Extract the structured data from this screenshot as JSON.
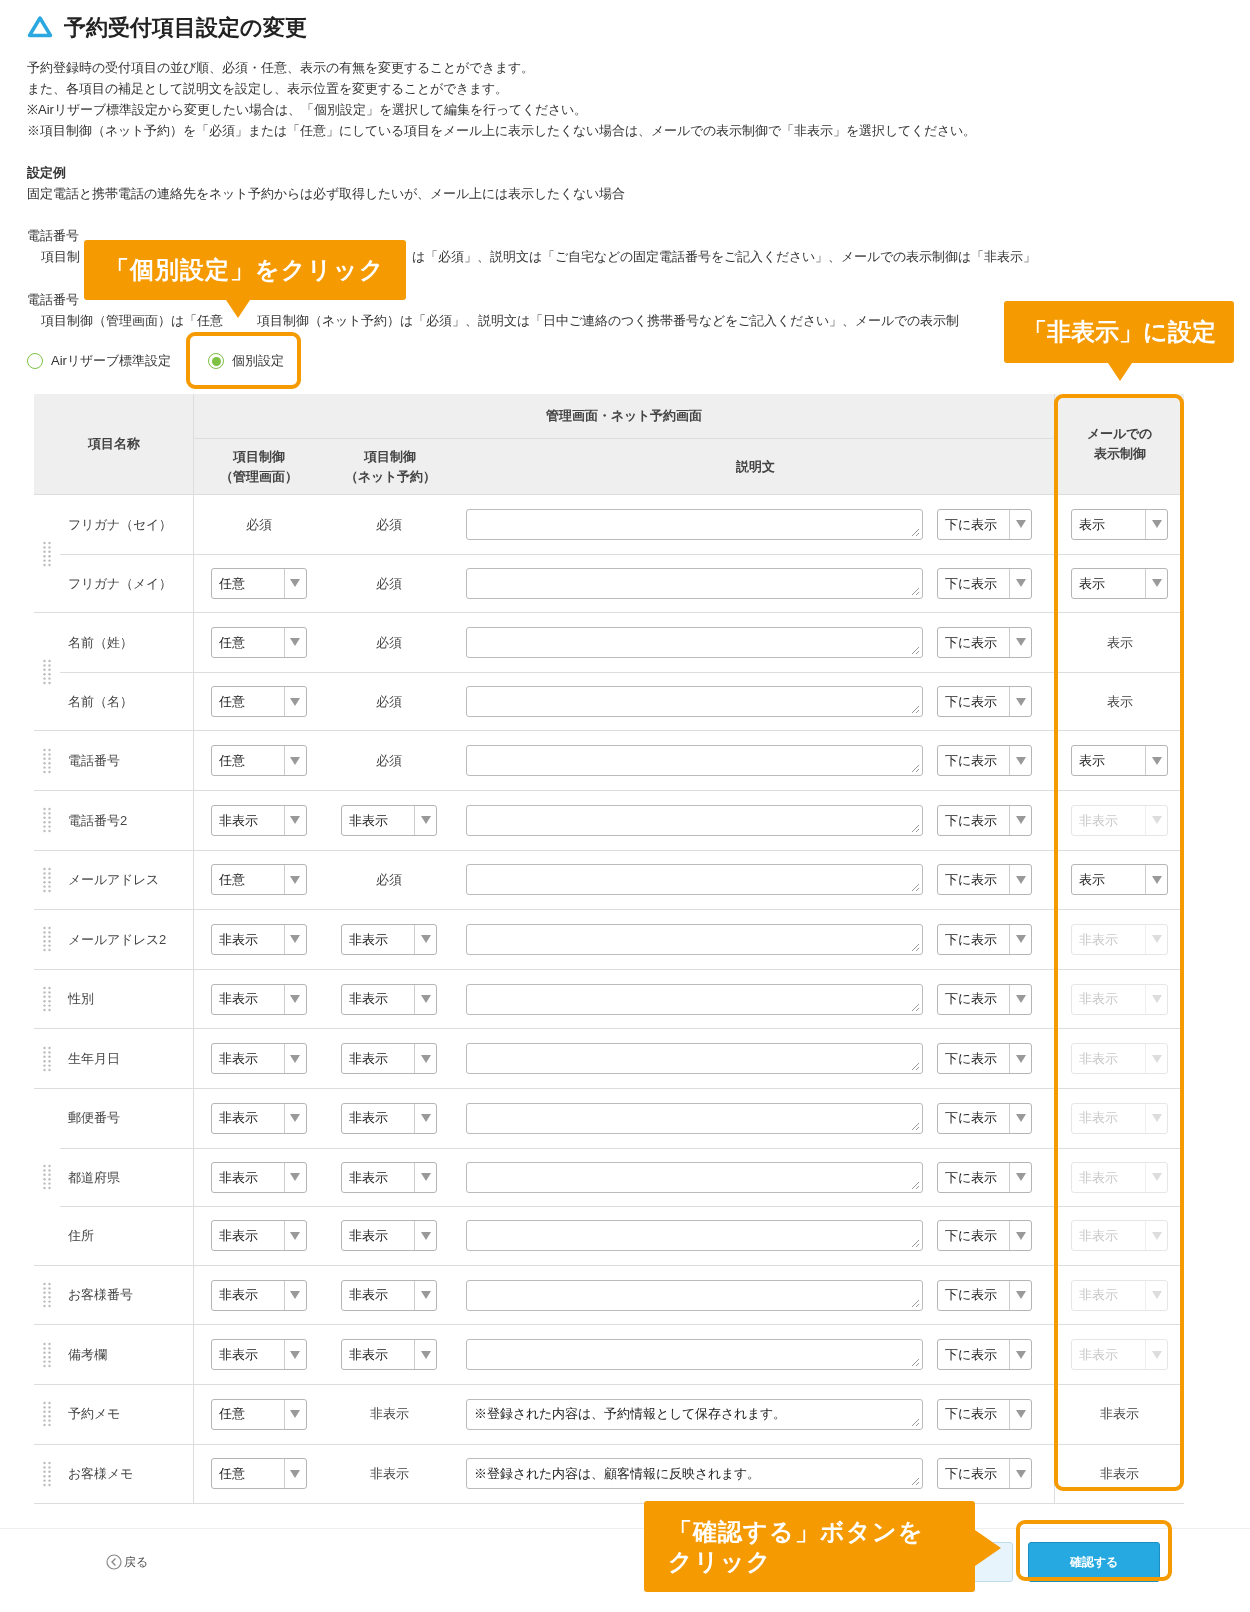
{
  "page": {
    "title": "予約受付項目設定の変更"
  },
  "intro": [
    "予約登録時の受付項目の並び順、必須・任意、表示の有無を変更することができます。",
    "また、各項目の補足として説明文を設定し、表示位置を変更することができます。",
    "※Airリザーブ標準設定から変更したい場合は、「個別設定」を選択して編集を行ってください。",
    "※項目制御（ネット予約）を「必須」または「任意」にしている項目をメール上に表示したくない場合は、メールでの表示制御で「非表示」を選択してください。"
  ],
  "example": {
    "heading": "設定例",
    "text": "固定電話と携帯電話の連絡先をネット予約からは必ず取得したいが、メール上には表示したくない場合",
    "items": [
      {
        "label": "電話番号",
        "segments": [
          "項目制",
          "は「必須」、説明文は「ご自宅などの固定電話番号をご記入ください」、メールでの表示制御は「非表示」"
        ]
      },
      {
        "label": "電話番号",
        "segments": [
          "項目制御（管理画面）は「任意",
          "項目制御（ネット予約）は「必須」、説明文は「日中ご連絡のつく携帯番号などをご記入ください」、メールでの表示制"
        ]
      }
    ]
  },
  "mode": [
    {
      "label": "Airリザーブ標準設定",
      "selected": false
    },
    {
      "label": "個別設定",
      "selected": true
    }
  ],
  "table": {
    "columns": {
      "name": "項目名称",
      "group": "管理画面・ネット予約画面",
      "admin": [
        "項目制御",
        "（管理画面）"
      ],
      "net": [
        "項目制御",
        "（ネット予約）"
      ],
      "description": "説明文",
      "mail": [
        "メールでの",
        "表示制御"
      ]
    },
    "groups": [
      {
        "rows": [
          {
            "name": "フリガナ（セイ）",
            "admin": {
              "kind": "text",
              "value": "必須"
            },
            "net": {
              "kind": "text",
              "value": "必須"
            },
            "position": "下に表示",
            "mail": {
              "kind": "select",
              "value": "表示",
              "disabled": false
            }
          },
          {
            "name": "フリガナ（メイ）",
            "admin": {
              "kind": "select",
              "value": "任意"
            },
            "net": {
              "kind": "text",
              "value": "必須"
            },
            "position": "下に表示",
            "mail": {
              "kind": "select",
              "value": "表示",
              "disabled": false
            }
          }
        ]
      },
      {
        "rows": [
          {
            "name": "名前（姓）",
            "admin": {
              "kind": "select",
              "value": "任意"
            },
            "net": {
              "kind": "text",
              "value": "必須"
            },
            "position": "下に表示",
            "mail": {
              "kind": "text",
              "value": "表示"
            }
          },
          {
            "name": "名前（名）",
            "admin": {
              "kind": "select",
              "value": "任意"
            },
            "net": {
              "kind": "text",
              "value": "必須"
            },
            "position": "下に表示",
            "mail": {
              "kind": "text",
              "value": "表示"
            }
          }
        ]
      },
      {
        "rows": [
          {
            "name": "電話番号",
            "admin": {
              "kind": "select",
              "value": "任意"
            },
            "net": {
              "kind": "text",
              "value": "必須"
            },
            "position": "下に表示",
            "mail": {
              "kind": "select",
              "value": "表示",
              "disabled": false
            }
          }
        ]
      },
      {
        "rows": [
          {
            "name": "電話番号2",
            "admin": {
              "kind": "select",
              "value": "非表示"
            },
            "net": {
              "kind": "select",
              "value": "非表示"
            },
            "position": "下に表示",
            "mail": {
              "kind": "select",
              "value": "非表示",
              "disabled": true
            }
          }
        ]
      },
      {
        "rows": [
          {
            "name": "メールアドレス",
            "admin": {
              "kind": "select",
              "value": "任意"
            },
            "net": {
              "kind": "text",
              "value": "必須"
            },
            "position": "下に表示",
            "mail": {
              "kind": "select",
              "value": "表示",
              "disabled": false
            }
          }
        ]
      },
      {
        "rows": [
          {
            "name": "メールアドレス2",
            "admin": {
              "kind": "select",
              "value": "非表示"
            },
            "net": {
              "kind": "select",
              "value": "非表示"
            },
            "position": "下に表示",
            "mail": {
              "kind": "select",
              "value": "非表示",
              "disabled": true
            }
          }
        ]
      },
      {
        "rows": [
          {
            "name": "性別",
            "admin": {
              "kind": "select",
              "value": "非表示"
            },
            "net": {
              "kind": "select",
              "value": "非表示"
            },
            "position": "下に表示",
            "mail": {
              "kind": "select",
              "value": "非表示",
              "disabled": true
            }
          }
        ]
      },
      {
        "rows": [
          {
            "name": "生年月日",
            "admin": {
              "kind": "select",
              "value": "非表示"
            },
            "net": {
              "kind": "select",
              "value": "非表示"
            },
            "position": "下に表示",
            "mail": {
              "kind": "select",
              "value": "非表示",
              "disabled": true
            }
          }
        ]
      },
      {
        "rows": [
          {
            "name": "郵便番号",
            "admin": {
              "kind": "select",
              "value": "非表示"
            },
            "net": {
              "kind": "select",
              "value": "非表示"
            },
            "position": "下に表示",
            "mail": {
              "kind": "select",
              "value": "非表示",
              "disabled": true
            }
          },
          {
            "name": "都道府県",
            "admin": {
              "kind": "select",
              "value": "非表示"
            },
            "net": {
              "kind": "select",
              "value": "非表示"
            },
            "position": "下に表示",
            "mail": {
              "kind": "select",
              "value": "非表示",
              "disabled": true
            }
          },
          {
            "name": "住所",
            "admin": {
              "kind": "select",
              "value": "非表示"
            },
            "net": {
              "kind": "select",
              "value": "非表示"
            },
            "position": "下に表示",
            "mail": {
              "kind": "select",
              "value": "非表示",
              "disabled": true
            }
          }
        ]
      },
      {
        "rows": [
          {
            "name": "お客様番号",
            "admin": {
              "kind": "select",
              "value": "非表示"
            },
            "net": {
              "kind": "select",
              "value": "非表示"
            },
            "position": "下に表示",
            "mail": {
              "kind": "select",
              "value": "非表示",
              "disabled": true
            }
          }
        ]
      },
      {
        "rows": [
          {
            "name": "備考欄",
            "admin": {
              "kind": "select",
              "value": "非表示"
            },
            "net": {
              "kind": "select",
              "value": "非表示"
            },
            "position": "下に表示",
            "mail": {
              "kind": "select",
              "value": "非表示",
              "disabled": true
            }
          }
        ]
      },
      {
        "rows": [
          {
            "name": "予約メモ",
            "admin": {
              "kind": "select",
              "value": "任意"
            },
            "net": {
              "kind": "text",
              "value": "非表示"
            },
            "description": "※登録された内容は、予約情報として保存されます。",
            "position": "下に表示",
            "mail": {
              "kind": "text",
              "value": "非表示"
            }
          }
        ]
      },
      {
        "rows": [
          {
            "name": "お客様メモ",
            "admin": {
              "kind": "select",
              "value": "任意"
            },
            "net": {
              "kind": "text",
              "value": "非表示"
            },
            "description": "※登録された内容は、顧客情報に反映されます。",
            "position": "下に表示",
            "mail": {
              "kind": "text",
              "value": "非表示"
            }
          }
        ]
      }
    ]
  },
  "footer": {
    "back": "戻る",
    "confirm": "確認する"
  },
  "callouts": [
    {
      "text": "「個別設定」をクリック"
    },
    {
      "text": "「非表示」に設定"
    },
    {
      "lines": [
        "「確認する」ボタンを",
        "クリック"
      ]
    }
  ]
}
